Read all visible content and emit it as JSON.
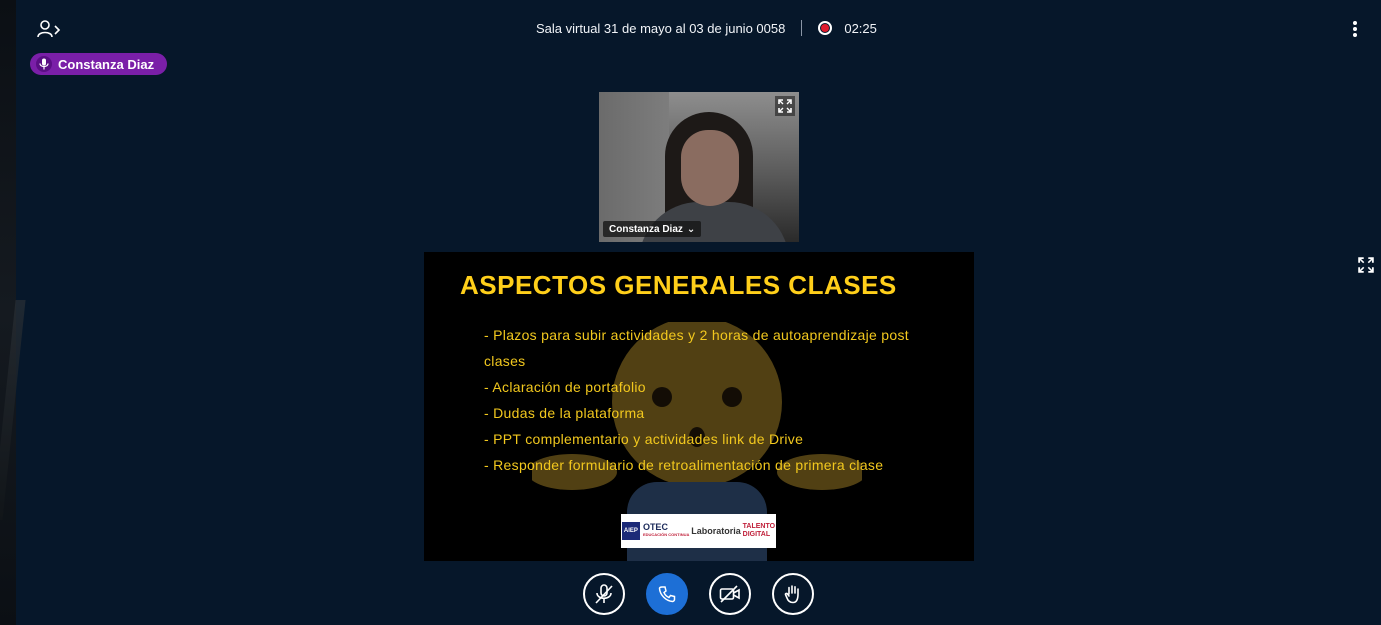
{
  "meeting": {
    "title": "Sala virtual 31 de mayo al 03 de junio 0058",
    "timer": "02:25",
    "recording": true
  },
  "talker": {
    "name": "Constanza Diaz"
  },
  "webcam": {
    "name": "Constanza Diaz",
    "caret": "⌄"
  },
  "slide": {
    "title": "ASPECTOS GENERALES CLASES",
    "items": [
      "- Plazos para subir actividades y 2 horas de autoaprendizaje post clases",
      "- Aclaración de portafolio",
      "- Dudas de la plataforma",
      "- PPT complementario y actividades link de Drive",
      "- Responder formulario de retroalimentación de primera clase"
    ],
    "logos": {
      "otec_badge": "AIEP",
      "otec_title": "OTEC",
      "otec_sub": "EDUCACIÓN CONTINUA",
      "lab": "Laboratoria",
      "talento_line1": "TALENTO",
      "talento_line2": "DIGITAL"
    }
  },
  "colors": {
    "background": "#06172a",
    "accent": "#1d6fd6",
    "talker_badge": "#7a1fa8",
    "slide_title": "#ffcf1a",
    "recording": "#e01b2d"
  },
  "icons": {
    "users": "user-list-icon",
    "more": "kebab-menu-icon",
    "mic_off": "mic-off-icon",
    "phone": "phone-icon",
    "camera_off": "camera-off-icon",
    "hand": "raise-hand-icon",
    "fullscreen": "fullscreen-icon"
  }
}
